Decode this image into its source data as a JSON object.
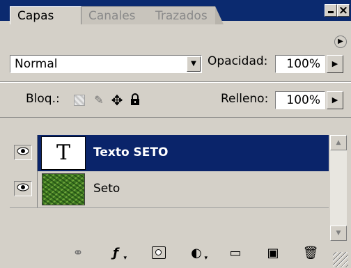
{
  "window": {
    "minimize_label": "",
    "close_label": "×"
  },
  "tabs": [
    {
      "label": "Capas",
      "active": true
    },
    {
      "label": "Canales",
      "active": false
    },
    {
      "label": "Trazados",
      "active": false
    }
  ],
  "palette_menu_icon": "▶",
  "blend": {
    "mode": "Normal",
    "dropdown_icon": "▼"
  },
  "opacity": {
    "label": "Opacidad:",
    "value": "100%",
    "button_icon": "▶"
  },
  "lock": {
    "label": "Bloq.:",
    "icons": [
      "lock-transparent-icon",
      "paintbrush-icon",
      "move-icon",
      "padlock-icon"
    ]
  },
  "fill": {
    "label": "Relleno:",
    "value": "100%",
    "button_icon": "▶"
  },
  "layers": [
    {
      "name": "Texto SETO",
      "thumbnail_text": "T",
      "selected": true,
      "visible": true
    },
    {
      "name": "Seto",
      "thumbnail_text": "",
      "selected": false,
      "visible": true
    }
  ],
  "eye_icon": "●",
  "scrollbar": {
    "up_icon": "▲",
    "down_icon": "▼"
  },
  "toolbar": [
    {
      "name": "link-icon",
      "glyph": "⚭"
    },
    {
      "name": "layer-style-icon",
      "glyph": "ƒ"
    },
    {
      "name": "layer-mask-icon",
      "glyph": ""
    },
    {
      "name": "adjustment-layer-icon",
      "glyph": "◐"
    },
    {
      "name": "new-group-icon",
      "glyph": "▭"
    },
    {
      "name": "new-layer-icon",
      "glyph": "▣"
    },
    {
      "name": "trash-icon",
      "glyph": "🗑"
    }
  ],
  "colors": {
    "titlebar": "#0b2a6f",
    "selection": "#0a246a",
    "panel": "#d4d0c8"
  }
}
